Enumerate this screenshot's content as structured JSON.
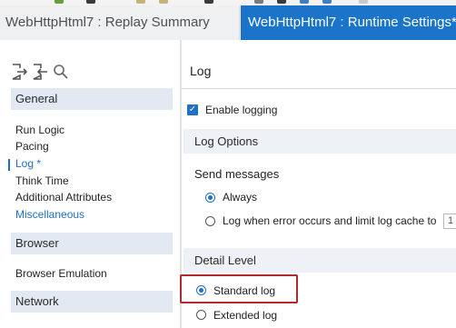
{
  "tabs": [
    {
      "label": "WebHttpHtml7 : Replay Summary",
      "active": false
    },
    {
      "label": "WebHttpHtml7 : Runtime Settings*",
      "active": true
    }
  ],
  "sidebar": {
    "tool_icons": [
      "export-icon",
      "import-icon",
      "search-icon"
    ],
    "sections": [
      {
        "header": "General",
        "items": [
          "Run Logic",
          "Pacing",
          "Log *",
          "Think Time",
          "Additional Attributes",
          "Miscellaneous"
        ]
      },
      {
        "header": "Browser",
        "items": [
          "Browser Emulation"
        ]
      },
      {
        "header": "Network",
        "items": []
      }
    ],
    "selected_item": "Log *"
  },
  "main": {
    "title": "Log",
    "enable_logging": {
      "label": "Enable logging",
      "checked": true
    },
    "log_options": {
      "header": "Log Options",
      "send_messages_label": "Send messages",
      "always_label": "Always",
      "always_selected": true,
      "on_error_label": "Log when error occurs and limit log cache to",
      "on_error_selected": false,
      "cache_value": "1"
    },
    "detail_level": {
      "header": "Detail Level",
      "standard_label": "Standard log",
      "standard_selected": true,
      "extended_label": "Extended log",
      "extended_selected": false
    }
  },
  "colors": {
    "accent": "#1f6fc2",
    "active_tab": "#1b74c9",
    "highlight": "#b02b2b"
  }
}
